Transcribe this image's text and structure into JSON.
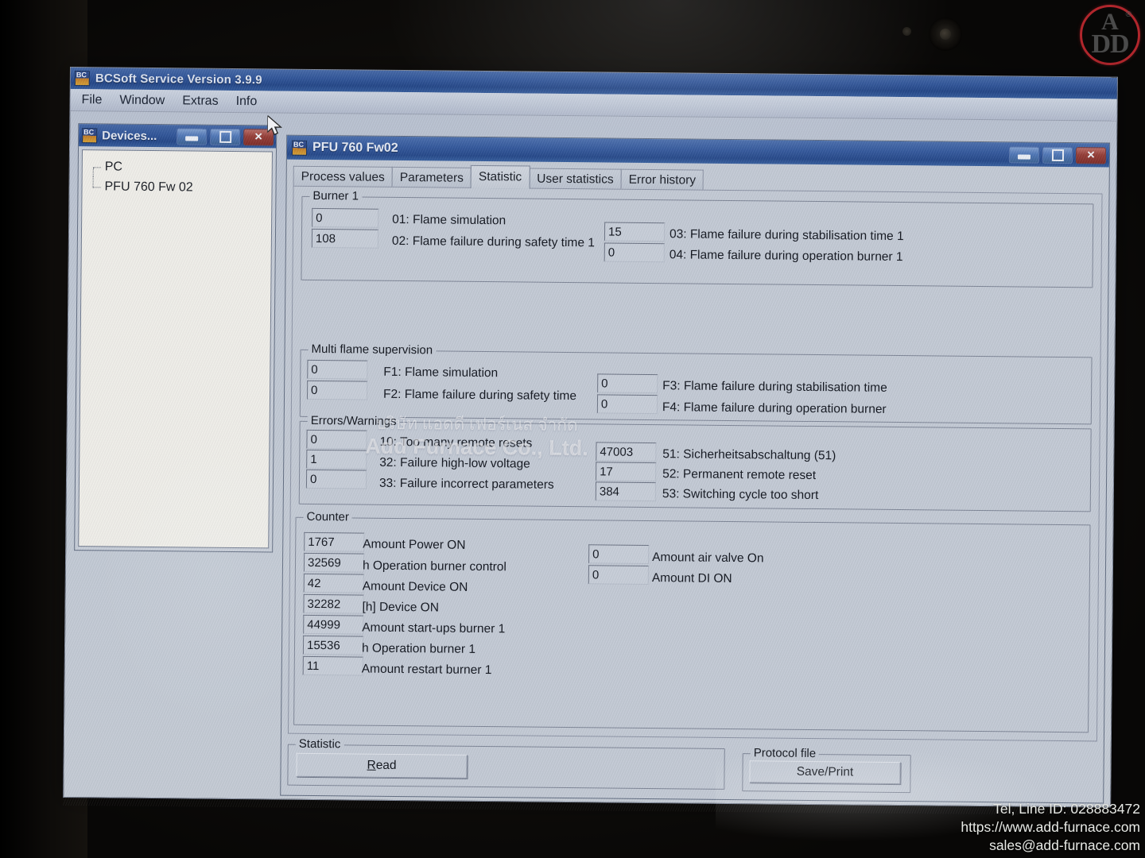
{
  "app": {
    "title": "BCSoft Service Version 3.9.9",
    "menu": [
      "File",
      "Window",
      "Extras",
      "Info"
    ]
  },
  "devices_window": {
    "title": "Devices...",
    "minimize": "",
    "maximize": "",
    "close": "✕",
    "tree": [
      "PC",
      "PFU 760 Fw 02"
    ]
  },
  "device_window": {
    "title": "PFU 760 Fw02",
    "minimize": "",
    "maximize": "",
    "close": "✕",
    "tabs": [
      {
        "label": "Process values",
        "active": false
      },
      {
        "label": "Parameters",
        "active": false
      },
      {
        "label": "Statistic",
        "active": true
      },
      {
        "label": "User statistics",
        "active": false
      },
      {
        "label": "Error history",
        "active": false
      }
    ]
  },
  "burner1": {
    "legend": "Burner 1",
    "left": [
      {
        "value": "0",
        "label": "01: Flame simulation"
      },
      {
        "value": "108",
        "label": "02: Flame failure during safety time 1"
      }
    ],
    "right": [
      {
        "value": "15",
        "label": "03: Flame failure during stabilisation time 1"
      },
      {
        "value": "0",
        "label": "04: Flame failure during operation burner 1"
      }
    ]
  },
  "multi_flame": {
    "legend": "Multi flame supervision",
    "left": [
      {
        "value": "0",
        "label": "F1: Flame simulation"
      },
      {
        "value": "0",
        "label": "F2: Flame failure during safety time"
      }
    ],
    "right": [
      {
        "value": "0",
        "label": "F3: Flame failure during stabilisation time"
      },
      {
        "value": "0",
        "label": "F4: Flame failure during operation burner"
      }
    ]
  },
  "errors_warnings": {
    "legend": "Errors/Warnings",
    "left": [
      {
        "value": "0",
        "label": "10: Too many remote resets"
      },
      {
        "value": "1",
        "label": "32: Failure high-low voltage"
      },
      {
        "value": "0",
        "label": "33: Failure incorrect parameters"
      }
    ],
    "right": [
      {
        "value": "47003",
        "label": "51: Sicherheitsabschaltung (51)"
      },
      {
        "value": "17",
        "label": "52: Permanent remote reset"
      },
      {
        "value": "384",
        "label": "53: Switching cycle too short"
      }
    ]
  },
  "counter": {
    "legend": "Counter",
    "left": [
      {
        "value": "1767",
        "label": "Amount Power ON"
      },
      {
        "value": "32569",
        "label": "h Operation burner control"
      },
      {
        "value": "42",
        "label": "Amount Device ON"
      },
      {
        "value": "32282",
        "label": "[h] Device ON"
      },
      {
        "value": "44999",
        "label": "Amount start-ups burner 1"
      },
      {
        "value": "15536",
        "label": "h Operation burner 1"
      },
      {
        "value": "11",
        "label": "Amount restart burner 1"
      }
    ],
    "right": [
      {
        "value": "0",
        "label": "Amount air valve On"
      },
      {
        "value": "0",
        "label": "Amount DI ON"
      }
    ]
  },
  "bottom": {
    "statistic_legend": "Statistic",
    "read_button": "Read",
    "read_button_accel": "R",
    "read_button_rest": "ead",
    "protocol_legend": "Protocol file",
    "save_print_button": "Save/Print"
  },
  "watermark": {
    "thai": "บริษัท แอดดี เฟอร์เนส จำกัด",
    "english": "Add Furnace Co., Ltd."
  },
  "logo": {
    "top_letter": "A",
    "bottom_letters": "DD",
    "registered": "®",
    "ring_color": "#b0262c"
  },
  "contact": {
    "line1": "Tel, Line ID: 028883472",
    "line2": "https://www.add-furnace.com",
    "line3": "sales@add-furnace.com"
  }
}
